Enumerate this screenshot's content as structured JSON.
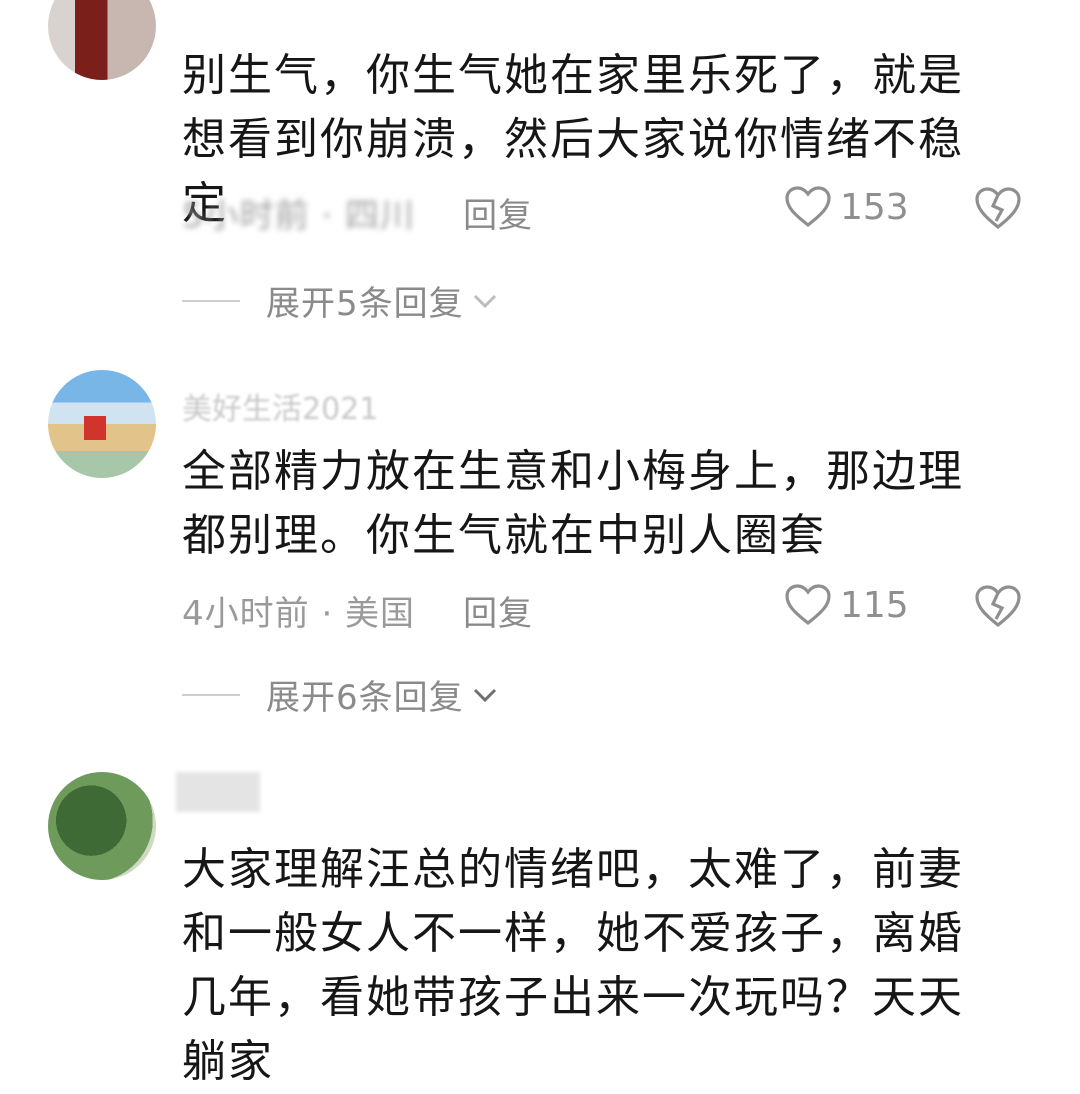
{
  "header": {
    "title": ""
  },
  "comments": [
    {
      "text": "别生气，你生气她在家里乐死了，就是想看到你崩溃，然后大家说你情绪不稳定",
      "meta": "5小时前 · 四川",
      "reply_label": "回复",
      "likes": "153",
      "expand_label": "展开5条回复"
    },
    {
      "name": "美好生活2021",
      "text": "全部精力放在生意和小梅身上，那边理都别理。你生气就在中别人圈套",
      "meta": "4小时前 · 美国",
      "reply_label": "回复",
      "likes": "115",
      "expand_label": "展开6条回复"
    },
    {
      "text": "大家理解汪总的情绪吧，太难了，前妻和一般女人不一样，她不爱孩子，离婚几年，看她带孩子出来一次玩吗？天天躺家"
    }
  ],
  "icons": {
    "like": "heart-outline-icon",
    "dislike": "broken-heart-icon",
    "expand": "chevron-down-icon"
  }
}
